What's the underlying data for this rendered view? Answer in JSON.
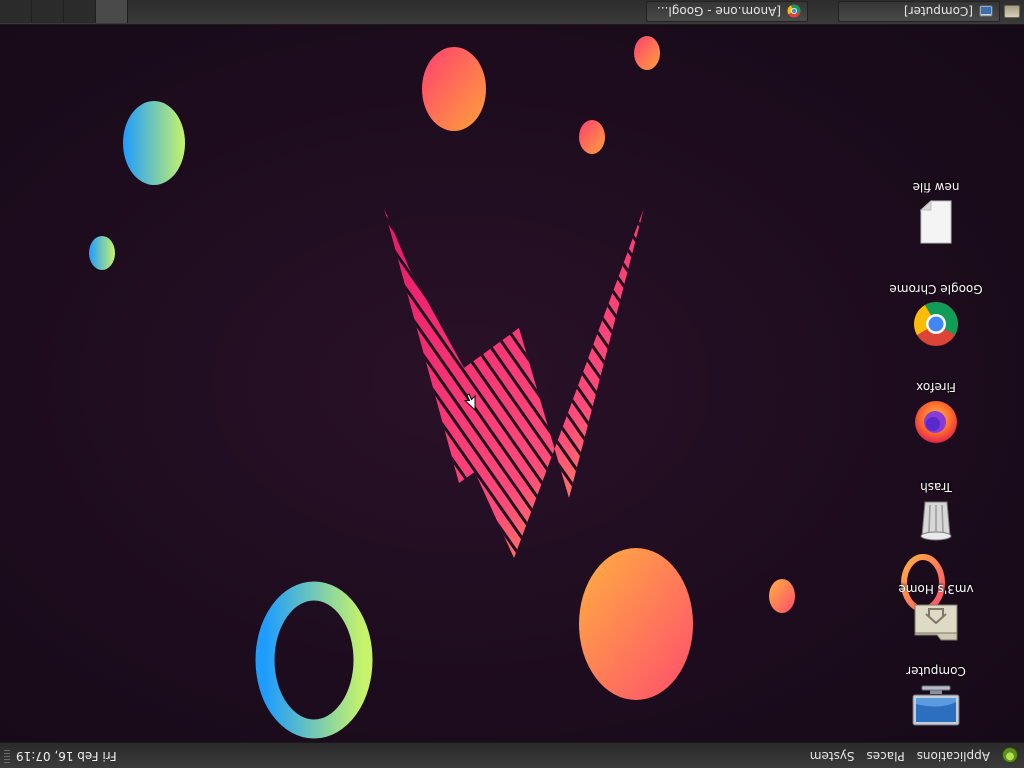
{
  "top_panel": {
    "menus": [
      "Applications",
      "Places",
      "System"
    ],
    "clock": "Fri Feb 16, 07:19"
  },
  "taskbar": {
    "windows": [
      {
        "label": "[Computer]",
        "icon": "folder-window-icon"
      },
      {
        "label": "[Anom.one - Googl...",
        "icon": "chrome-icon"
      }
    ],
    "workspaces": 4,
    "active_workspace": 1
  },
  "desktop": {
    "icons": [
      {
        "label": "Computer",
        "icon": "computer-icon"
      },
      {
        "label": "vm3's Home",
        "icon": "home-folder-icon"
      },
      {
        "label": "Trash",
        "icon": "trash-icon"
      },
      {
        "label": "Firefox",
        "icon": "firefox-icon"
      },
      {
        "label": "Google Chrome",
        "icon": "chrome-icon"
      },
      {
        "label": "new file",
        "icon": "file-icon"
      }
    ]
  },
  "colors": {
    "wallpaper_bg": "#1d0c1e",
    "panel_bg": "#333333",
    "accent_pink": "#ff2f7a",
    "accent_orange": "#ff8a3a",
    "accent_yellow": "#ffd23a"
  }
}
